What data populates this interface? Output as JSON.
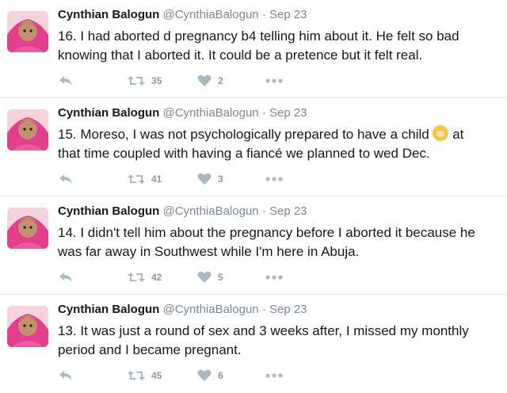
{
  "tweets": [
    {
      "name": "Cynthian Balogun",
      "handle": "@CynthiaBalogun",
      "time": "Sep 23",
      "text": "16. I had aborted d pregnancy b4 telling him about it. He felt so bad knowing that I aborted it. It could be a pretence but it felt real.",
      "retweets": "35",
      "likes": "2"
    },
    {
      "name": "Cynthian Balogun",
      "handle": "@CynthiaBalogun",
      "time": "Sep 23",
      "text_before_emoji": "15. Moreso, I was not psychologically prepared to have a child",
      "emoji": "baby-emoji",
      "text_after_emoji": "at that time coupled with having a fiancé we planned to wed Dec.",
      "retweets": "41",
      "likes": "3"
    },
    {
      "name": "Cynthian Balogun",
      "handle": "@CynthiaBalogun",
      "time": "Sep 23",
      "text": "14. I didn't tell him about the pregnancy before I aborted it because he was far away in Southwest while I'm here in Abuja.",
      "retweets": "42",
      "likes": "5"
    },
    {
      "name": "Cynthian Balogun",
      "handle": "@CynthiaBalogun",
      "time": "Sep 23",
      "text": "13. It was just a round of sex and 3 weeks after, I missed my monthly period and I became pregnant.",
      "retweets": "45",
      "likes": "6"
    }
  ],
  "separator": "·",
  "icons": {
    "reply": "reply-icon",
    "retweet": "retweet-icon",
    "like": "heart-icon",
    "more": "more-icon"
  },
  "colors": {
    "action_icon": "#aab8c2",
    "meta_text": "#7b8893",
    "divider": "#e1e8ed"
  }
}
